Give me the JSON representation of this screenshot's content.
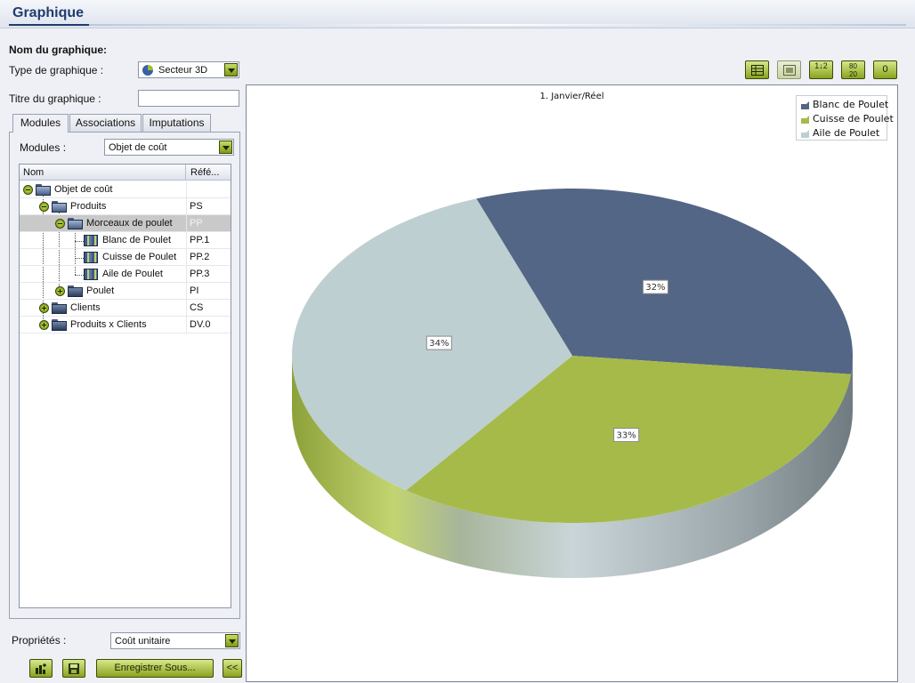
{
  "page": {
    "title": "Graphique"
  },
  "form": {
    "name_label": "Nom du graphique:",
    "type_label": "Type de graphique :",
    "type_value": "Secteur 3D",
    "title_label": "Titre du graphique :",
    "title_value": ""
  },
  "tabs": [
    {
      "label": "Modules",
      "active": true
    },
    {
      "label": "Associations",
      "active": false
    },
    {
      "label": "Imputations",
      "active": false
    }
  ],
  "modules": {
    "label": "Modules :",
    "value": "Objet de coût",
    "tree": {
      "col_name": "Nom",
      "col_ref": "Réfé...",
      "rows": [
        {
          "name": "Objet de coût",
          "ref": "",
          "level": 0,
          "expanded": true,
          "icon": "folder",
          "selected": false
        },
        {
          "name": "Produits",
          "ref": "PS",
          "level": 1,
          "expanded": true,
          "icon": "folder",
          "selected": false
        },
        {
          "name": "Morceaux de poulet",
          "ref": "PP",
          "level": 2,
          "expanded": true,
          "icon": "folder",
          "selected": true
        },
        {
          "name": "Blanc de Poulet",
          "ref": "PP.1",
          "level": 3,
          "expanded": null,
          "icon": "item",
          "selected": false
        },
        {
          "name": "Cuisse de Poulet",
          "ref": "PP.2",
          "level": 3,
          "expanded": null,
          "icon": "item",
          "selected": false
        },
        {
          "name": "Aile de Poulet",
          "ref": "PP.3",
          "level": 3,
          "expanded": null,
          "icon": "item",
          "selected": false
        },
        {
          "name": "Poulet",
          "ref": "PI",
          "level": 2,
          "expanded": false,
          "icon": "folder",
          "selected": false
        },
        {
          "name": "Clients",
          "ref": "CS",
          "level": 1,
          "expanded": false,
          "icon": "folder",
          "selected": false
        },
        {
          "name": "Produits x Clients",
          "ref": "DV.0",
          "level": 1,
          "expanded": false,
          "icon": "folder",
          "selected": false
        }
      ]
    }
  },
  "properties": {
    "label": "Propriétés :",
    "value": "Coût unitaire"
  },
  "buttons": {
    "save_as": "Enregistrer Sous...",
    "collapse": "<<",
    "toolbar_sort": "1↓2",
    "toolbar_ratio_top": "80",
    "toolbar_ratio_bottom": "20",
    "toolbar_zero": "0"
  },
  "colors": {
    "accent": "#8aa31e",
    "slice1": "#546685",
    "slice2": "#a6ba4a",
    "slice3": "#bdcfd1"
  },
  "chart_data": {
    "type": "pie",
    "variant": "3d",
    "title": "1. Janvier/Réel",
    "categories": [
      "Blanc de Poulet",
      "Cuisse de Poulet",
      "Aile de Poulet"
    ],
    "values": [
      32,
      33,
      34
    ],
    "labels": [
      "32%",
      "33%",
      "34%"
    ],
    "legend_position": "top-right"
  }
}
